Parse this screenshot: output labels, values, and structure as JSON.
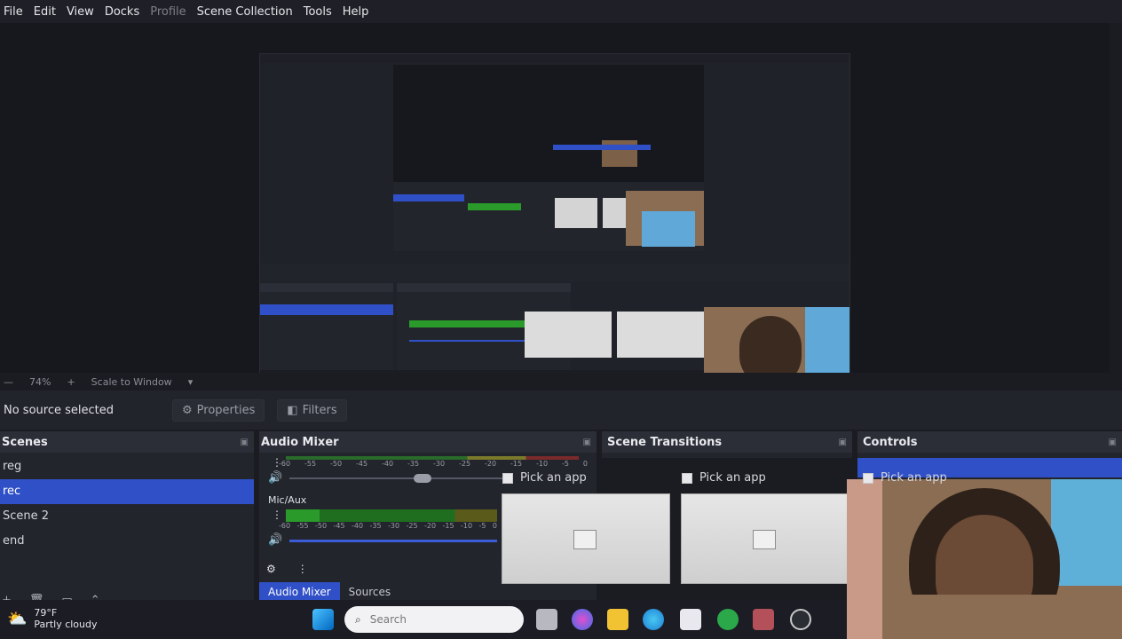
{
  "menu": [
    "File",
    "Edit",
    "View",
    "Docks",
    "Profile",
    "Scene Collection",
    "Tools",
    "Help"
  ],
  "menu_disabled": "Profile",
  "zoom": {
    "value": "74%",
    "mode": "Scale to Window"
  },
  "properties_bar": {
    "no_source": "No source selected",
    "properties": "Properties",
    "filters": "Filters"
  },
  "scenes": {
    "title": "Scenes",
    "items": [
      "reg",
      "rec",
      "Scene 2",
      "end"
    ],
    "selected_index": 1
  },
  "audio_mixer": {
    "title": "Audio Mixer",
    "ticks": [
      "-60",
      "-55",
      "-50",
      "-45",
      "-40",
      "-35",
      "-30",
      "-25",
      "-20",
      "-15",
      "-10",
      "-5",
      "0"
    ],
    "channel2_label": "Mic/Aux"
  },
  "scene_transitions": {
    "title": "Scene Transitions"
  },
  "controls": {
    "title": "Controls"
  },
  "pick_app": "Pick an app",
  "bottom_tabs": [
    "Audio Mixer",
    "Sources"
  ],
  "taskbar": {
    "temperature": "79°F",
    "condition": "Partly cloudy",
    "search": "Search"
  },
  "colors": {
    "accent": "#3050c8",
    "meter_green": "#2a9a2a",
    "bg": "#1b1c22"
  }
}
